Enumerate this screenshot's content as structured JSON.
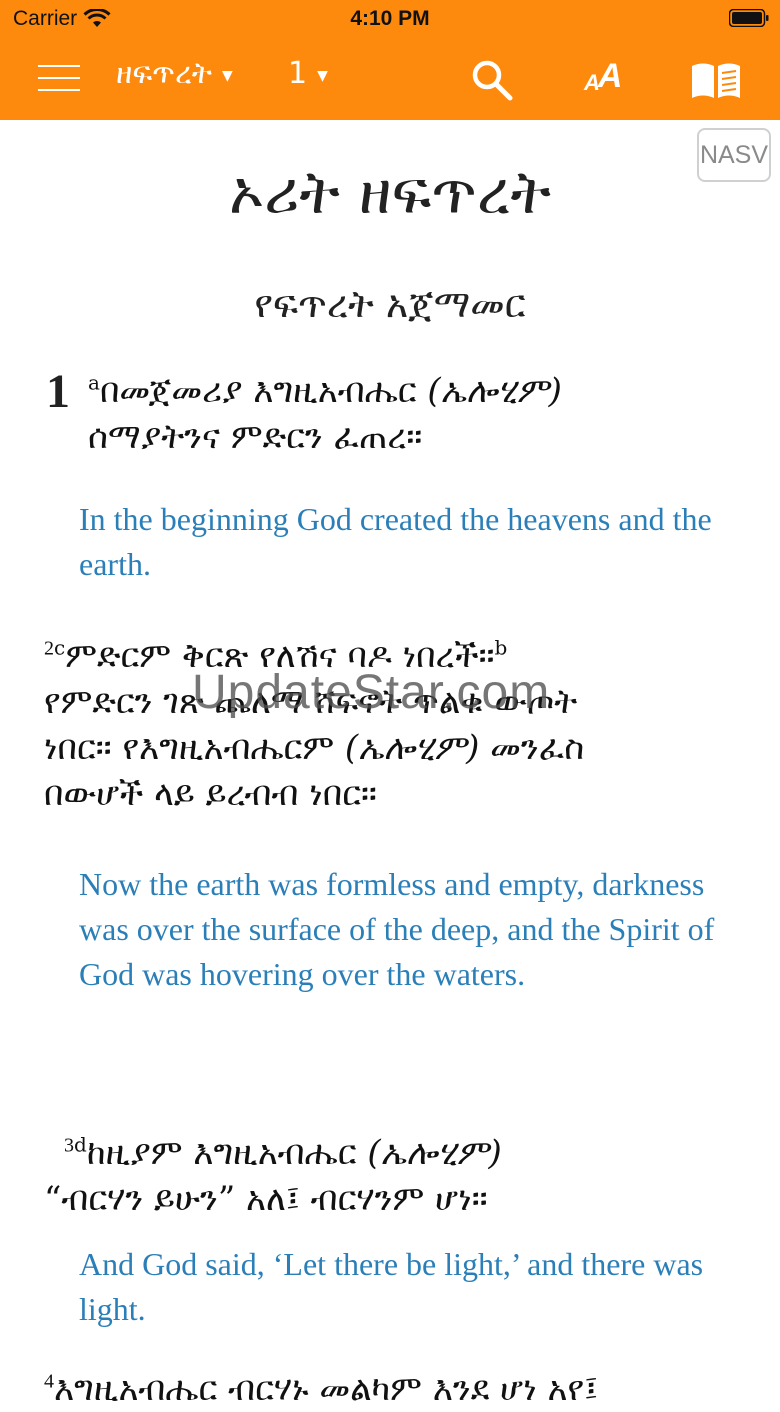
{
  "status_bar": {
    "carrier": "Carrier",
    "time": "4:10 PM"
  },
  "nav": {
    "book": "ዘፍጥረት",
    "chapter": "1",
    "icons": [
      "menu-icon",
      "search-icon",
      "font-size-icon",
      "book-icon"
    ],
    "font_small": "A",
    "font_big": "A",
    "accent_color": "#fd8a0d"
  },
  "translation_button": "NASV",
  "content": {
    "book_title": "ኦሪት ዘፍጥረት",
    "section_heading": "የፍጥረት አጀማመር",
    "chapter_number": "1",
    "verses": [
      {
        "number": "",
        "footnote_mark": "a",
        "amharic_line1": "በመጀመሪያ እግዚአብሔር ",
        "amharic_italic1": "(ኤሎሂም)",
        "amharic_line2": "ሰማያትንና ምድርን ፈጠረ።",
        "english": "In the beginning God created the heavens and the earth."
      },
      {
        "number": "2",
        "footnote_mark": "c",
        "footnote_mark2": "b",
        "amharic_line1": "ምድርም ቅርጽ የለሽና ባዶ ነበረች።",
        "amharic_line2": "የምድርን ገጽ ጨለማ ሸፍኖት ጥልቁ ውጦት",
        "amharic_line3a": "ነበር። የእግዚአብሔርም ",
        "amharic_italic3": "(ኤሎሂም)",
        "amharic_line3b": " መንፈስ",
        "amharic_line4": "በውሆች ላይ ይረብብ ነበር።",
        "english": "Now the earth was formless and empty, darkness was over the surface of the deep, and the Spirit of God was hovering over the waters."
      },
      {
        "number": "3",
        "footnote_mark": "d",
        "amharic_line1": "ከዚያም እግዚአብሔር ",
        "amharic_italic1": "(ኤሎሂም)",
        "amharic_line2": "“ብርሃን ይሁን” አለ፤ ብርሃንም ሆነ።",
        "english": "And God said, ‘Let there be light,’ and there was light."
      },
      {
        "number": "4",
        "amharic_line1": "እግዚአብሔር ብርሃኑ መልካም እንደ ሆነ አየ፤"
      }
    ]
  },
  "watermark": "UpdateStar.com"
}
